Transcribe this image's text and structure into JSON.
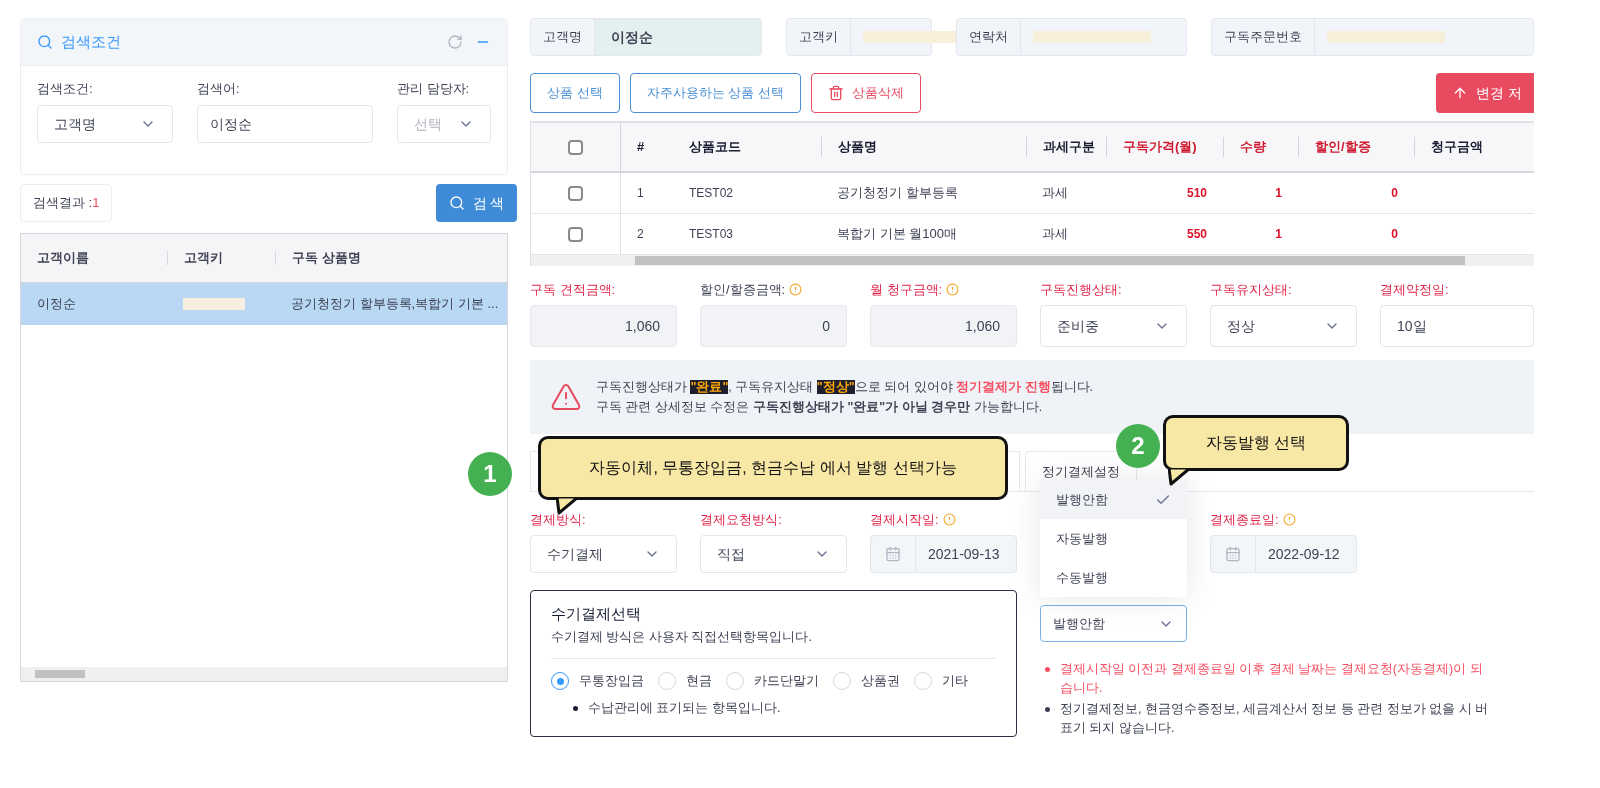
{
  "search_panel": {
    "title": "검색조건",
    "fields": [
      {
        "kind": "select",
        "label": "검색조건:",
        "value": "고객명"
      },
      {
        "kind": "input",
        "label": "검색어:",
        "value": "이정순"
      },
      {
        "kind": "select",
        "label": "관리 담당자:",
        "placeholder": "선택"
      }
    ]
  },
  "result_count": {
    "label": "검색결과 :",
    "count": "1"
  },
  "search_button": "검 색",
  "customer_table": {
    "columns": [
      "고객이름",
      "고객키",
      "구독 상품명"
    ],
    "rows": [
      {
        "name": "이정순",
        "product": "공기청정기 할부등록,복합기 기본 ...",
        "selected": true
      }
    ]
  },
  "info_cards": [
    {
      "label": "고객명",
      "value": "이정순",
      "redacted": false
    },
    {
      "label": "고객키",
      "redacted": true
    },
    {
      "label": "연락처",
      "redacted": true
    },
    {
      "label": "구독주문번호",
      "redacted": true
    }
  ],
  "buttons": [
    {
      "kind": "outline",
      "label": "상품 선택"
    },
    {
      "kind": "outline",
      "label": "자주사용하는 상품 선택"
    },
    {
      "kind": "danger",
      "label": "상품삭제"
    }
  ],
  "save_button": "변경 저",
  "product_table": {
    "all_checked": false,
    "columns": [
      {
        "label": "#",
        "required": false
      },
      {
        "label": "상품코드",
        "required": false
      },
      {
        "label": "상품명",
        "required": false
      },
      {
        "label": "과세구분",
        "required": false
      },
      {
        "label": "구독가격(월)",
        "required": true
      },
      {
        "label": "수량",
        "required": true
      },
      {
        "label": "할인/할증",
        "required": true
      },
      {
        "label": "청구금액",
        "required": false
      }
    ],
    "rows": [
      {
        "checked": false,
        "no": "1",
        "code": "TEST02",
        "name": "공기청정기 할부등록",
        "tax": "과세",
        "price": "510",
        "qty": "1",
        "discount": "0"
      },
      {
        "checked": false,
        "no": "2",
        "code": "TEST03",
        "name": "복합기 기본 월100매",
        "tax": "과세",
        "price": "550",
        "qty": "1",
        "discount": "0"
      }
    ]
  },
  "summary_fields": [
    {
      "kind": "amount",
      "label": "구독 견적금액:",
      "required": true,
      "info": false,
      "value": "1,060"
    },
    {
      "kind": "amount",
      "label": "할인/할증금액:",
      "required": false,
      "info": true,
      "value": "0"
    },
    {
      "kind": "amount",
      "label": "월 청구금액:",
      "required": true,
      "info": true,
      "value": "1,060"
    },
    {
      "kind": "select",
      "label": "구독진행상태:",
      "required": true,
      "info": false,
      "value": "준비중"
    },
    {
      "kind": "select",
      "label": "구독유지상태:",
      "required": true,
      "info": false,
      "value": "정상"
    },
    {
      "kind": "input",
      "label": "결제약정일:",
      "required": true,
      "info": false,
      "value": "10일"
    }
  ],
  "notice": {
    "line1": [
      {
        "kind": "plain",
        "text": "구독진행상태가 "
      },
      {
        "kind": "highlight",
        "text": "\"완료\""
      },
      {
        "kind": "plain",
        "text": ", 구독유지상태 "
      },
      {
        "kind": "highlight",
        "text": "\"정상\""
      },
      {
        "kind": "plain",
        "text": "으로 되어 있어야 "
      },
      {
        "kind": "emphasis",
        "text": "정기결제가 진행"
      },
      {
        "kind": "plain",
        "text": "됩니다."
      }
    ],
    "line2": "구독 관련 상세정보 수정은 **구독진행상태가 \"완료\"가 아닐 경우만** 가능합니다."
  },
  "tabs": [
    {
      "label": "정기결제설정"
    }
  ],
  "payment_fields": [
    {
      "kind": "select",
      "label": "결제방식:",
      "info": false,
      "value": "수기결제"
    },
    {
      "kind": "select",
      "label": "결제요청방식:",
      "info": false,
      "value": "직접"
    },
    {
      "kind": "date",
      "label": "결제시작일:",
      "info": true,
      "value": "2021-09-13"
    },
    {
      "kind": "blank"
    },
    {
      "kind": "date",
      "label": "결제종료일:",
      "info": true,
      "value": "2022-09-12"
    }
  ],
  "issue_dropdown": {
    "value": "발행안함",
    "options": [
      {
        "label": "발행안함",
        "selected": true
      },
      {
        "label": "자동발행",
        "selected": false
      },
      {
        "label": "수동발행",
        "selected": false
      }
    ]
  },
  "manual_box": {
    "title": "수기결제선택",
    "description": "수기결제 방식은 사용자 직접선택항목입니다.",
    "options": [
      {
        "label": "무통장입금",
        "selected": true
      },
      {
        "label": "현금",
        "selected": false
      },
      {
        "label": "카드단말기",
        "selected": false
      },
      {
        "label": "상품권",
        "selected": false
      },
      {
        "label": "기타",
        "selected": false
      }
    ],
    "note": "수납관리에 표기되는 항목입니다."
  },
  "notes": [
    {
      "kind": "warning",
      "lines": [
        "결제시작일 이전과 결제종료일 이후 결제 날짜는 결제요청(자동결제)이 되",
        "습니다."
      ]
    },
    {
      "kind": "info",
      "lines": [
        "정기결제정보, 현금영수증정보, 세금계산서 정보 등 관련 정보가 없을 시 버",
        "표기 되지 않습니다."
      ]
    }
  ],
  "callouts": [
    {
      "number": "1",
      "text": "자동이체, 무통장입금, 현금수납 에서 발행 선택가능"
    },
    {
      "number": "2",
      "text": "자동발행 선택"
    }
  ]
}
